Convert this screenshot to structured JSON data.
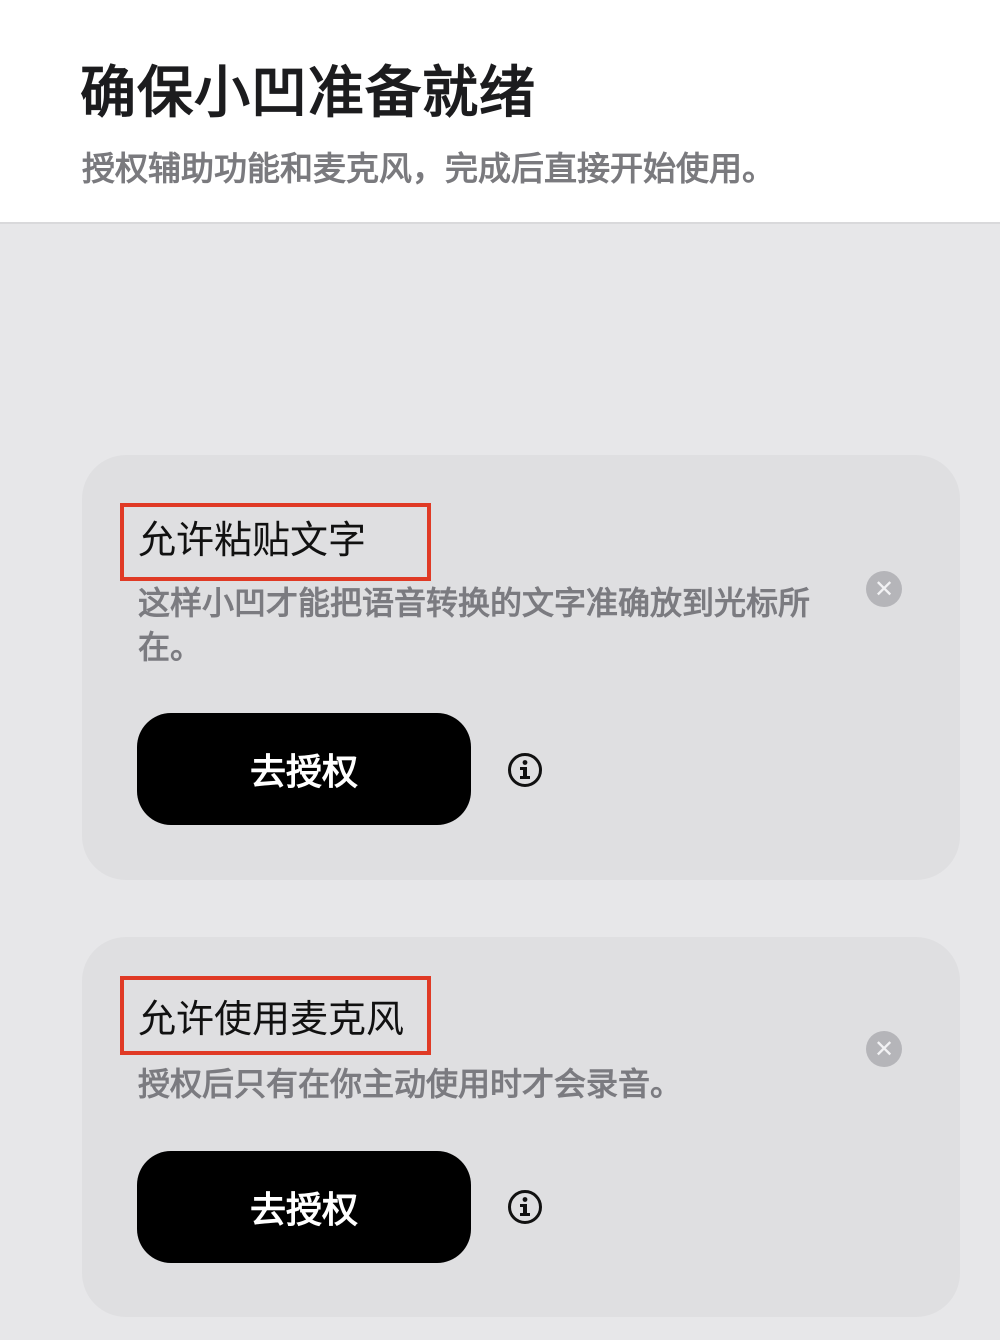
{
  "header": {
    "title": "确保小凹准备就绪",
    "subtitle": "授权辅助功能和麦克风，完成后直接开始使用。"
  },
  "cards": [
    {
      "title": "允许粘贴文字",
      "description": "这样小凹才能把语音转换的文字准确放到光标所在。",
      "button_label": "去授权",
      "close_icon": "close-circle-icon",
      "info_icon": "info-circle-icon"
    },
    {
      "title": "允许使用麦克风",
      "description": "授权后只有在你主动使用时才会录音。",
      "button_label": "去授权",
      "close_icon": "close-circle-icon",
      "info_icon": "info-circle-icon"
    }
  ],
  "colors": {
    "background": "#e7e7e9",
    "card": "#dfdfe1",
    "button": "#000000",
    "highlight": "#e03a25"
  }
}
